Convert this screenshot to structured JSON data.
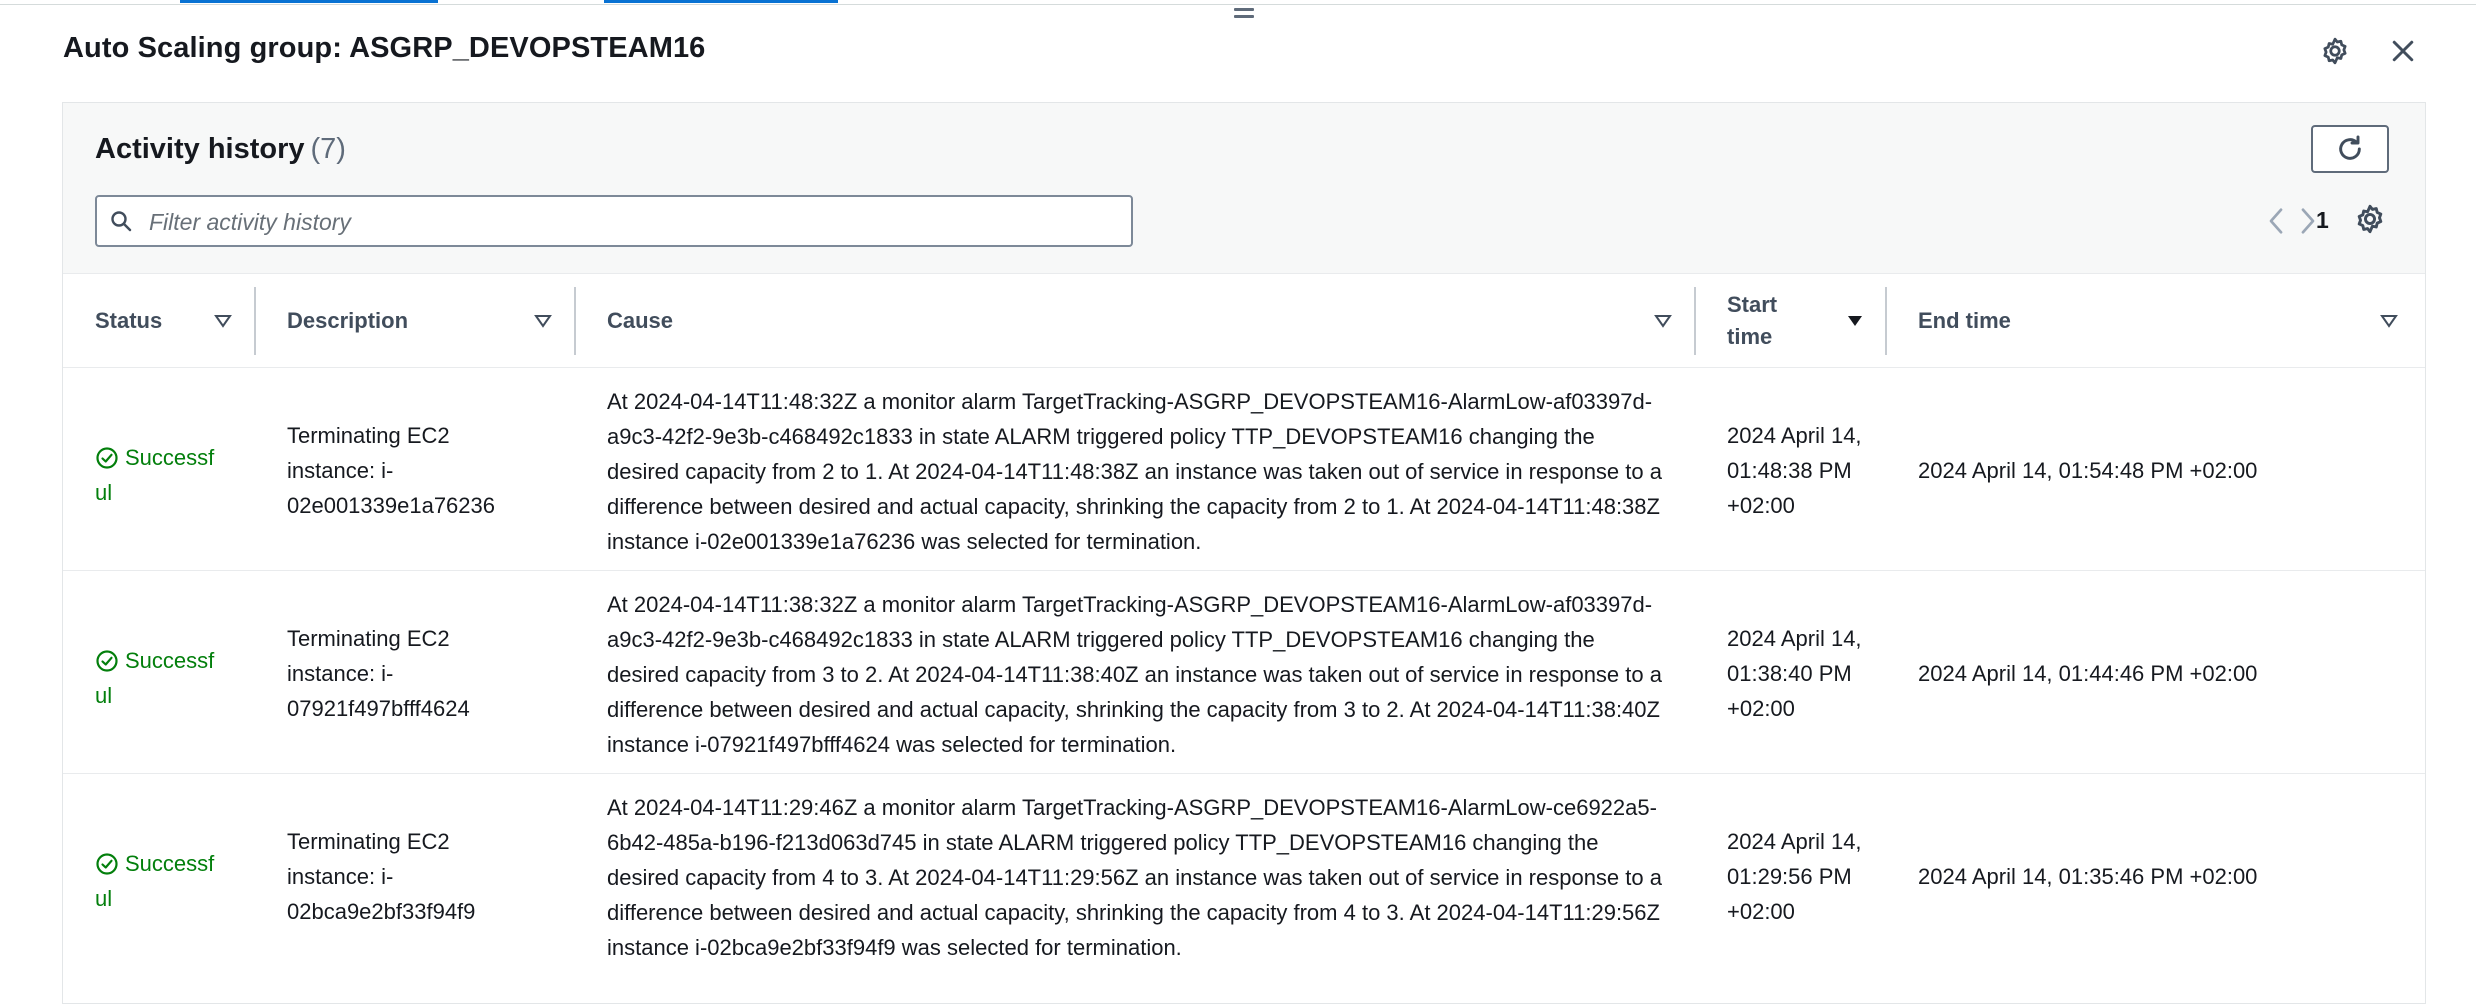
{
  "panel": {
    "title": "Auto Scaling group: ASGRP_DEVOPSTEAM16"
  },
  "activity": {
    "title": "Activity history",
    "count": "(7)",
    "filter_placeholder": "Filter activity history",
    "page": "1",
    "columns": {
      "status": "Status",
      "description": "Description",
      "cause": "Cause",
      "start_time": "Start time",
      "end_time": "End time"
    },
    "rows": [
      {
        "status": "Successful",
        "description": "Terminating EC2 instance: i-02e001339e1a76236",
        "cause": "At 2024-04-14T11:48:32Z a monitor alarm TargetTracking-ASGRP_DEVOPSTEAM16-AlarmLow-af03397d-a9c3-42f2-9e3b-c468492c1833 in state ALARM triggered policy TTP_DEVOPSTEAM16 changing the desired capacity from 2 to 1. At 2024-04-14T11:48:38Z an instance was taken out of service in response to a difference between desired and actual capacity, shrinking the capacity from 2 to 1. At 2024-04-14T11:48:38Z instance i-02e001339e1a76236 was selected for termination.",
        "start_time": "2024 April 14, 01:48:38 PM +02:00",
        "end_time": "2024 April 14, 01:54:48 PM +02:00"
      },
      {
        "status": "Successful",
        "description": "Terminating EC2 instance: i-07921f497bfff4624",
        "cause": "At 2024-04-14T11:38:32Z a monitor alarm TargetTracking-ASGRP_DEVOPSTEAM16-AlarmLow-af03397d-a9c3-42f2-9e3b-c468492c1833 in state ALARM triggered policy TTP_DEVOPSTEAM16 changing the desired capacity from 3 to 2. At 2024-04-14T11:38:40Z an instance was taken out of service in response to a difference between desired and actual capacity, shrinking the capacity from 3 to 2. At 2024-04-14T11:38:40Z instance i-07921f497bfff4624 was selected for termination.",
        "start_time": "2024 April 14, 01:38:40 PM +02:00",
        "end_time": "2024 April 14, 01:44:46 PM +02:00"
      },
      {
        "status": "Successful",
        "description": "Terminating EC2 instance: i-02bca9e2bf33f94f9",
        "cause": "At 2024-04-14T11:29:46Z a monitor alarm TargetTracking-ASGRP_DEVOPSTEAM16-AlarmLow-ce6922a5-6b42-485a-b196-f213d063d745 in state ALARM triggered policy TTP_DEVOPSTEAM16 changing the desired capacity from 4 to 3. At 2024-04-14T11:29:56Z an instance was taken out of service in response to a difference between desired and actual capacity, shrinking the capacity from 4 to 3. At 2024-04-14T11:29:56Z instance i-02bca9e2bf33f94f9 was selected for termination.",
        "start_time": "2024 April 14, 01:29:56 PM +02:00",
        "end_time": "2024 April 14, 01:35:46 PM +02:00"
      }
    ]
  },
  "icons": {
    "drag": "drag-handle-icon",
    "settings": "gear-icon",
    "close": "close-icon",
    "refresh": "refresh-icon",
    "search": "search-icon",
    "prev": "chevron-left-icon",
    "next": "chevron-right-icon",
    "sort": "caret-down-icon",
    "success": "status-success-icon"
  },
  "colors": {
    "accent": "#0972d3",
    "success": "#037f0c",
    "text": "#16191f",
    "muted": "#5f6b7a"
  }
}
